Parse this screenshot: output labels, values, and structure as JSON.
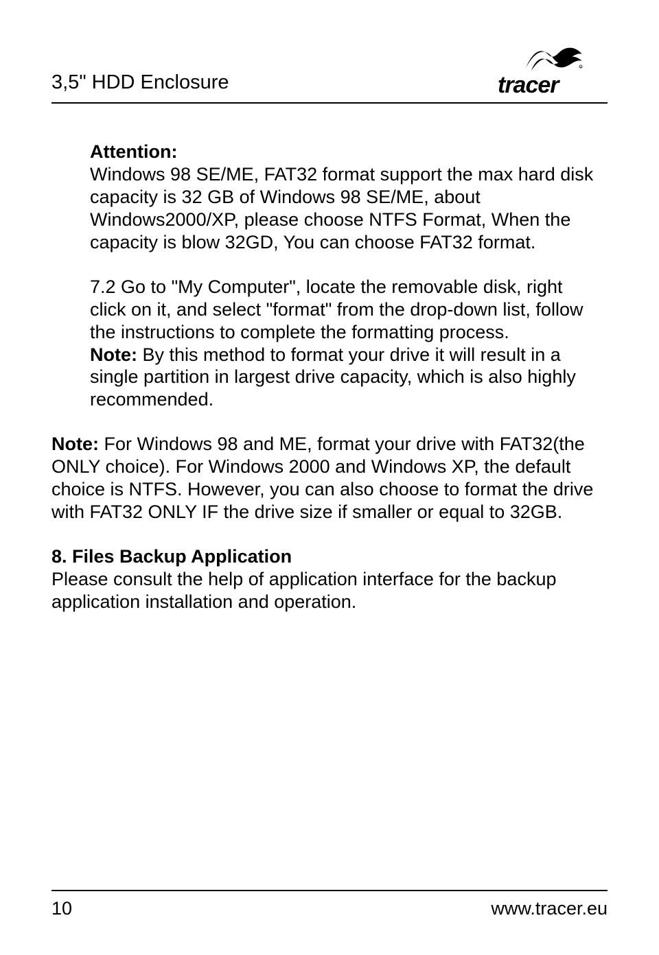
{
  "header": {
    "title": "3,5\" HDD Enclosure",
    "brand": "tracer"
  },
  "content": {
    "attention_label": "Attention:",
    "attention_body": "Windows 98 SE/ME, FAT32 format support the max hard disk capacity is 32 GB of Windows 98 SE/ME, about Windows2000/XP, please choose NTFS Format, When the capacity is blow 32GD, You can choose FAT32 format.",
    "step72_a": "7.2 Go to \"My Computer\", locate the removable disk, right click on it, and select \"format\" from the drop-down list, follow the instructions to complete the formatting process.",
    "step72_note_label": "Note:",
    "step72_note_body": " By this method to format your drive it will result in a single partition in largest drive capacity, which is also highly recommended.",
    "note2_label": "Note:",
    "note2_body": " For Windows 98 and ME, format your drive with FAT32(the ONLY choice). For Windows 2000 and Windows XP, the default choice is NTFS. However, you can also choose to format the drive with FAT32 ONLY IF the drive size if smaller or equal to 32GB.",
    "section8_title": "8. Files Backup Application",
    "section8_body": "Please consult the help of application interface for the backup application installation and operation."
  },
  "footer": {
    "page": "10",
    "url": "www.tracer.eu"
  }
}
